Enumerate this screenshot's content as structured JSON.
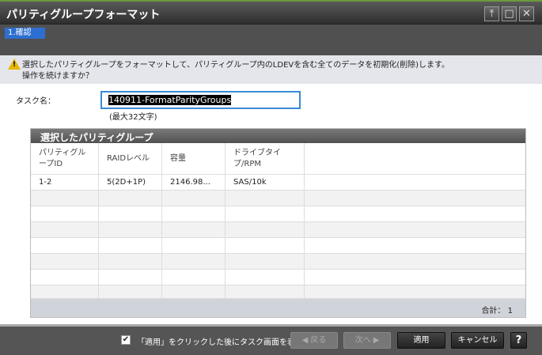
{
  "window": {
    "title": "パリティグループフォーマット",
    "buttons": [
      "pin",
      "maximize",
      "close"
    ]
  },
  "steps": [
    {
      "label": "1.確認",
      "active": true
    }
  ],
  "warning": {
    "line1": "選択したパリティグループをフォーマットして、パリティグループ内のLDEVを含む全てのデータを初期化(削除)します。",
    "line2": "操作を続けますか？"
  },
  "task": {
    "label": "タスク名：",
    "value": "140911-FormatParityGroups",
    "hint": "(最大32文字)"
  },
  "table": {
    "title": "選択したパリティグループ",
    "columns": [
      "パリティグループID",
      "RAIDレベル",
      "容量",
      "ドライブタイプ/RPM"
    ],
    "rows": [
      [
        "1-2",
        "5(2D+1P)",
        "2146.98...",
        "SAS/10k"
      ]
    ],
    "total_label": "合計：",
    "total": "1"
  },
  "footer": {
    "checkbox_label": "「適用」をクリックした後にタスク画面を表示",
    "checked": true,
    "back": "◀ 戻る",
    "next": "次へ ▶",
    "apply": "適用",
    "cancel": "キャンセル",
    "help": "?"
  }
}
